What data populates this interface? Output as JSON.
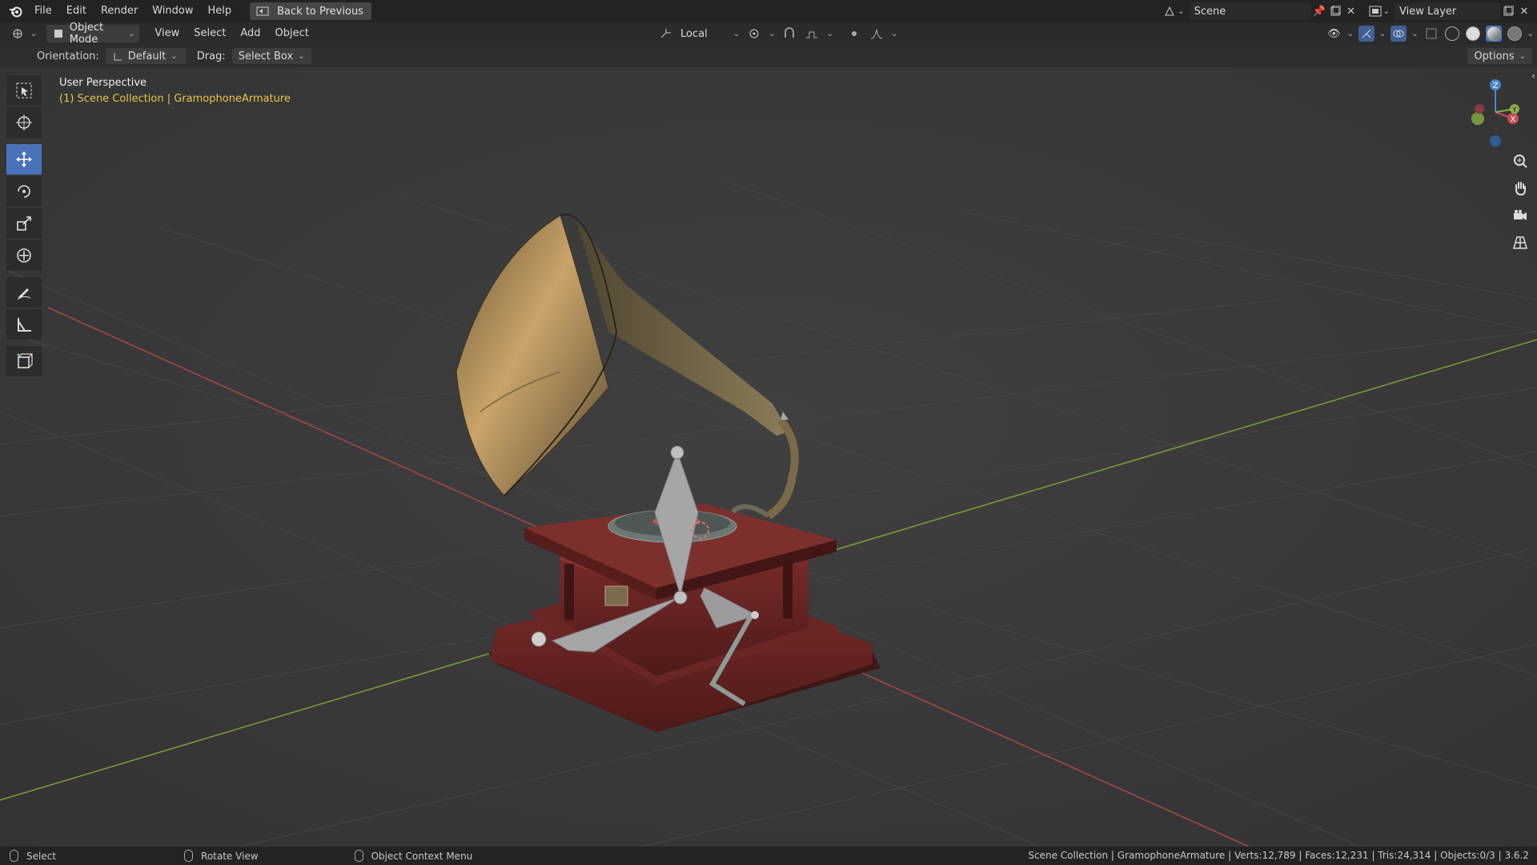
{
  "topbar": {
    "menus": [
      "File",
      "Edit",
      "Render",
      "Window",
      "Help"
    ],
    "back_button": "Back to Previous",
    "scene_name": "Scene",
    "view_layer": "View Layer"
  },
  "header": {
    "mode": "Object Mode",
    "menus": [
      "View",
      "Select",
      "Add",
      "Object"
    ],
    "transform_pivot": "Local"
  },
  "tool_settings": {
    "orientation_label": "Orientation:",
    "orientation_value": "Default",
    "drag_label": "Drag:",
    "drag_value": "Select Box",
    "options_label": "Options"
  },
  "viewport": {
    "view_name": "User Perspective",
    "collection_info": "(1) Scene Collection | GramophoneArmature"
  },
  "gizmo": {
    "z_label": "Z",
    "x_label": "X",
    "y_label": "Y"
  },
  "statusbar": {
    "select": "Select",
    "rotate": "Rotate View",
    "context": "Object Context Menu",
    "stats": "Scene Collection | GramophoneArmature | Verts:12,789 | Faces:12,231 | Tris:24,314 | Objects:0/3 | 3.6.2"
  },
  "colors": {
    "accent": "#4a72b8",
    "x_axis": "#c84d57",
    "y_axis": "#8bb04a",
    "z_axis": "#4a86c8",
    "active_text": "#e7c64a"
  }
}
